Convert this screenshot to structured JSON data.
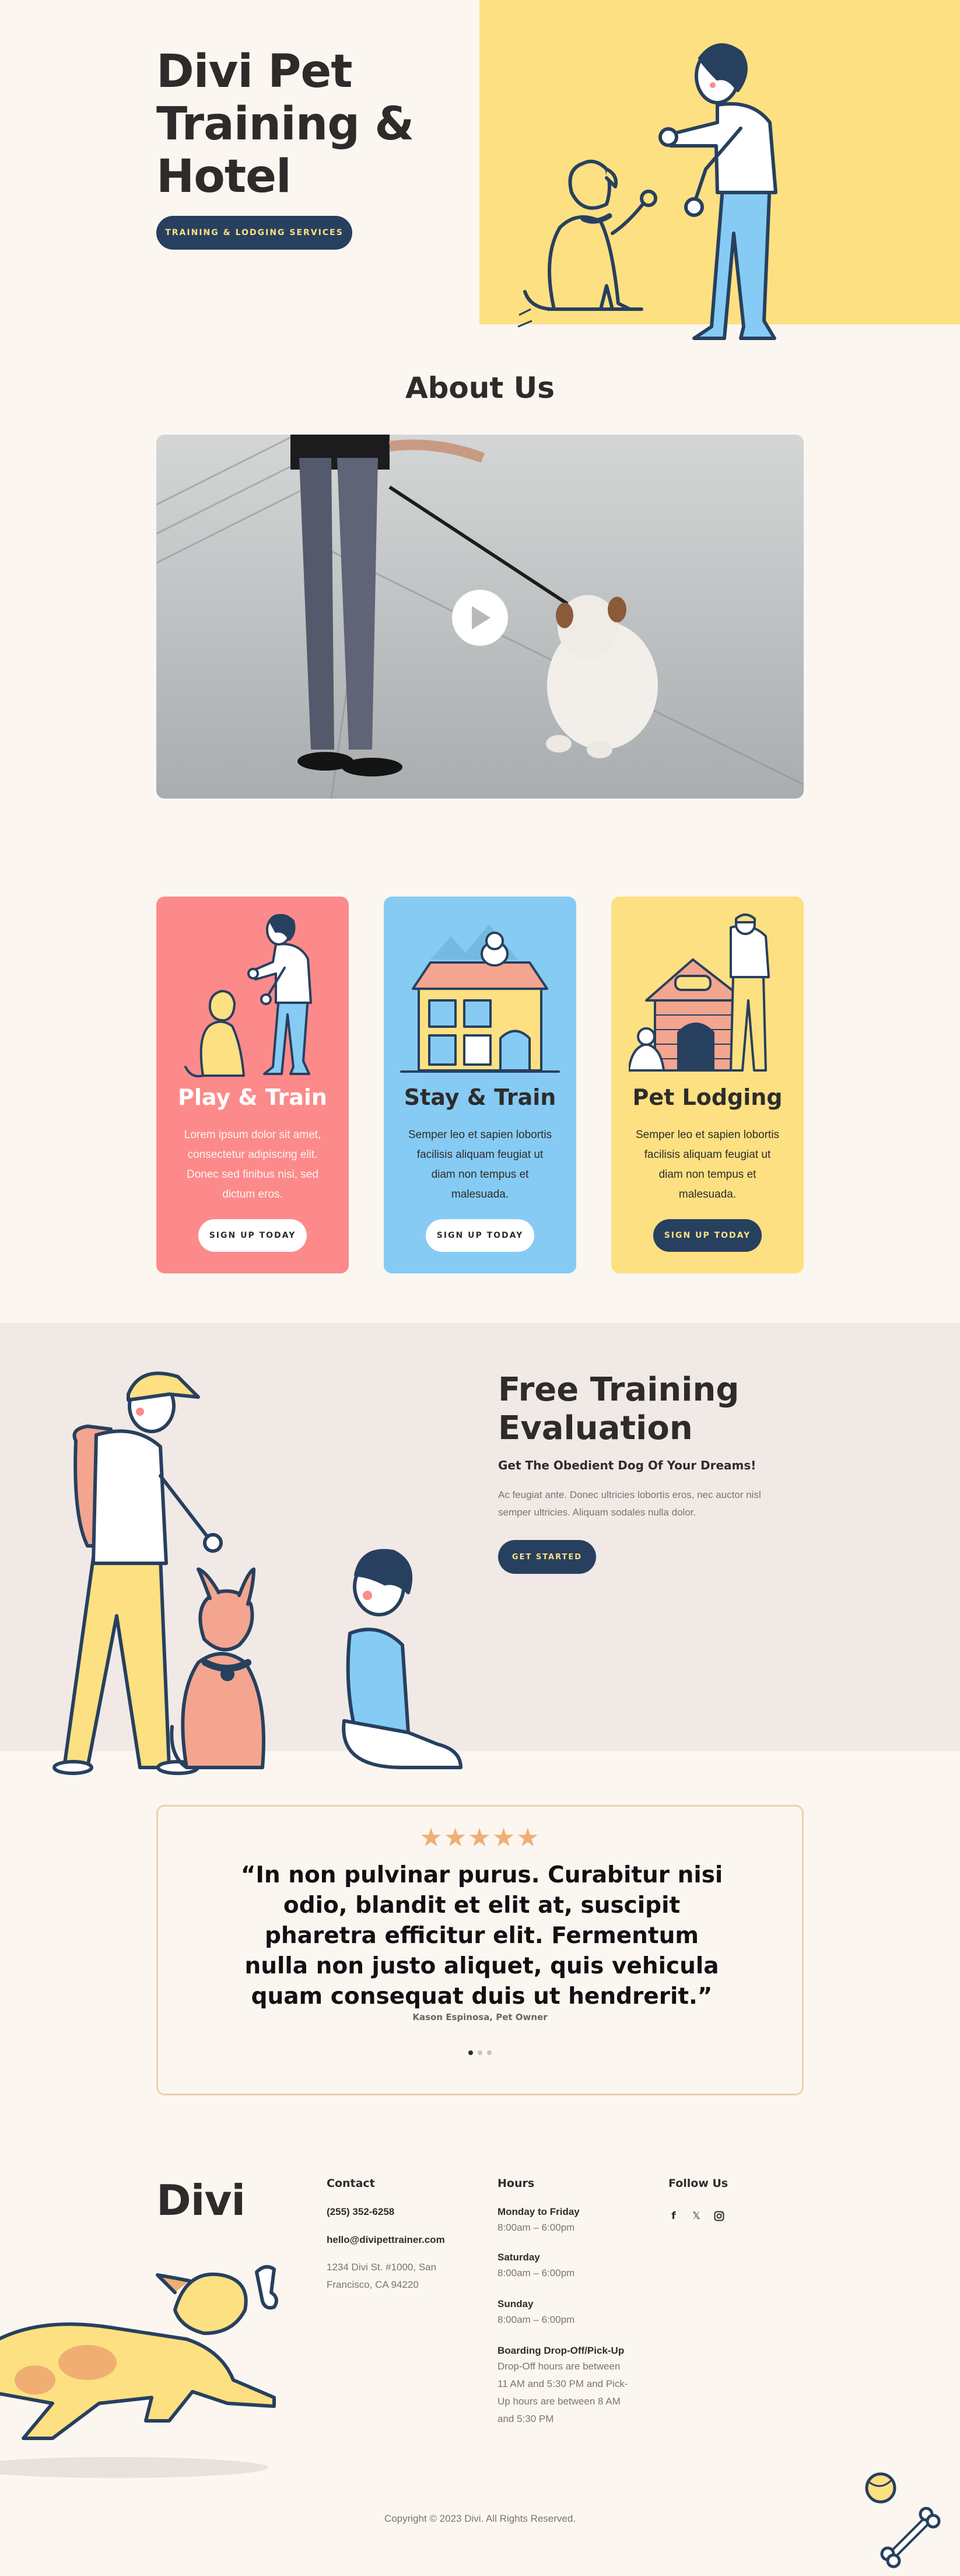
{
  "hero": {
    "title_line1": "Divi Pet",
    "title_line2": "Training &",
    "title_line3": "Hotel",
    "button_label": "Training & Lodging Services"
  },
  "about": {
    "title": "About Us"
  },
  "services": [
    {
      "title": "Play & Train",
      "text": "Lorem ipsum dolor sit amet, consectetur adipiscing elit. Donec sed finibus nisi, sed dictum eros.",
      "button_label": "Sign Up Today",
      "bg": "#fc8a8a"
    },
    {
      "title": "Stay & Train",
      "text": "Semper leo et sapien lobortis facilisis aliquam feugiat ut diam non tempus et malesuada.",
      "button_label": "Sign Up Today",
      "bg": "#86cbf4"
    },
    {
      "title": "Pet Lodging",
      "text": "Semper leo et sapien lobortis facilisis aliquam feugiat ut diam non tempus et malesuada.",
      "button_label": "Sign Up Today",
      "bg": "#fde081"
    }
  ],
  "evaluation": {
    "title_line1": "Free Training",
    "title_line2": "Evaluation",
    "subtitle": "Get The Obedient Dog Of Your Dreams!",
    "text": "Ac feugiat ante. Donec ultricies lobortis eros, nec auctor nisl semper ultricies. Aliquam sodales nulla dolor.",
    "button_label": "Get Started"
  },
  "testimonial": {
    "stars": "★★★★★",
    "quote": "“In non pulvinar purus. Curabitur nisi odio, blandit et elit at, suscipit pharetra efficitur elit. Fermentum nulla non justo aliquet, quis vehicula quam consequat duis ut hendrerit.”",
    "author": "Kason Espinosa, Pet Owner"
  },
  "footer": {
    "logo": "Divi",
    "contact": {
      "heading": "Contact",
      "phone": "(255) 352-6258",
      "email": "hello@divipettrainer.com",
      "address": "1234 Divi St. #1000, San Francisco, CA 94220"
    },
    "hours": {
      "heading": "Hours",
      "weekdays_label": "Monday to Friday",
      "weekdays_hours": "8:00am – 6:00pm",
      "saturday_label": "Saturday",
      "saturday_hours": "8:00am – 6:00pm",
      "sunday_label": "Sunday",
      "sunday_hours": "8:00am – 6:00pm",
      "boarding_label": "Boarding Drop-Off/Pick-Up",
      "boarding_text": "Drop-Off hours are between 11 AM and 5:30 PM and Pick-Up hours are between 8 AM and 5:30 PM"
    },
    "follow": {
      "heading": "Follow Us",
      "icons": [
        "facebook-icon",
        "x-icon",
        "instagram-icon"
      ]
    },
    "copyright": "Copyright © 2023 Divi. All Rights Reserved."
  },
  "colors": {
    "navy": "#27405f",
    "yellow": "#fde081",
    "coral": "#fc8a8a",
    "sky": "#86cbf4",
    "cream": "#fcf6f1",
    "beige": "#f1e9e5",
    "star": "#f0ae73"
  }
}
